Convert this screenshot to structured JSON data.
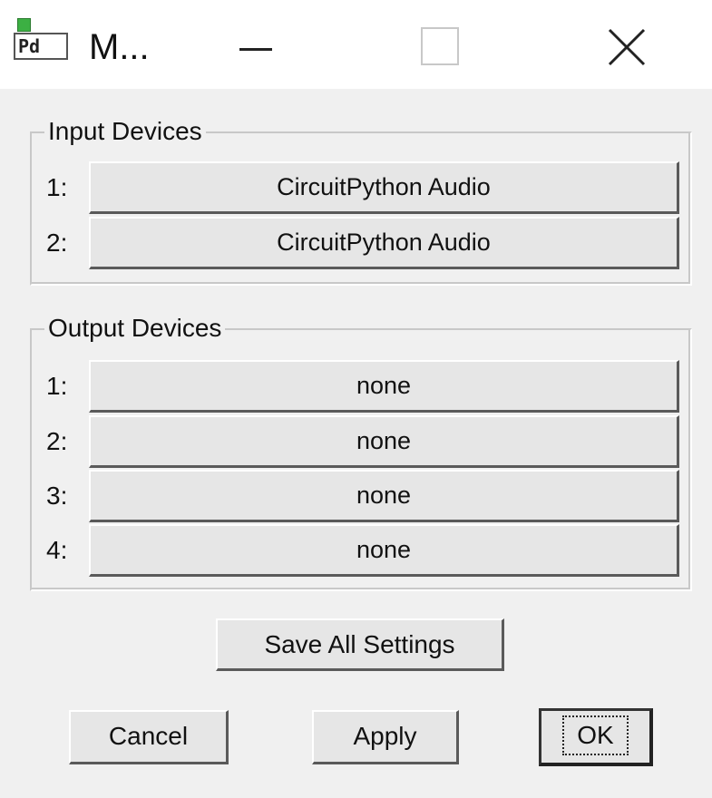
{
  "titlebar": {
    "icon_text": "Pd",
    "title": "M...",
    "minimize_icon": "minimize-icon",
    "maximize_icon": "maximize-icon",
    "close_icon": "close-icon"
  },
  "input_devices": {
    "label": "Input Devices",
    "rows": [
      {
        "num": "1:",
        "device": "CircuitPython Audio"
      },
      {
        "num": "2:",
        "device": "CircuitPython Audio"
      }
    ]
  },
  "output_devices": {
    "label": "Output Devices",
    "rows": [
      {
        "num": "1:",
        "device": "none"
      },
      {
        "num": "2:",
        "device": "none"
      },
      {
        "num": "3:",
        "device": "none"
      },
      {
        "num": "4:",
        "device": "none"
      }
    ]
  },
  "buttons": {
    "save_all": "Save All Settings",
    "cancel": "Cancel",
    "apply": "Apply",
    "ok": "OK"
  },
  "colors": {
    "app_icon_dot": "#3cb043",
    "window_bg": "#f0f0f0",
    "titlebar_bg": "#ffffff"
  }
}
